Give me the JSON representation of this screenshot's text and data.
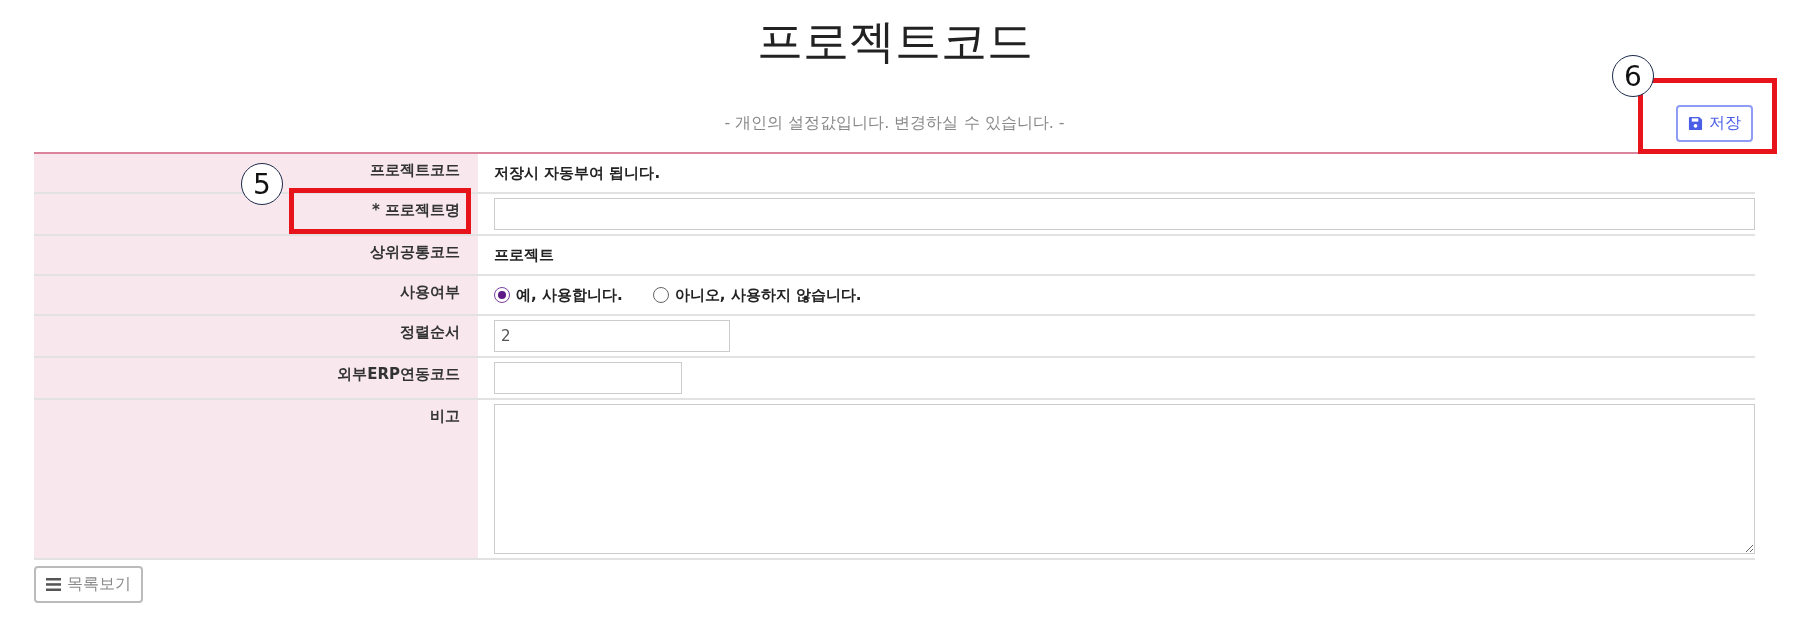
{
  "title": "프로젝트코드",
  "subtitle": "- 개인의 설정값입니다. 변경하실 수 있습니다. -",
  "save_button": "저장",
  "form": [
    {
      "kind": "text",
      "label": "프로젝트코드",
      "value": "저장시 자동부여 됩니다."
    },
    {
      "kind": "input",
      "label": "* 프로젝트명"
    },
    {
      "kind": "text",
      "label": "상위공통코드",
      "value": "프로젝트"
    },
    {
      "kind": "radio",
      "label": "사용여부",
      "options": [
        {
          "label": "예, 사용합니다.",
          "selected": true
        },
        {
          "label": "아니오, 사용하지 않습니다.",
          "selected": false
        }
      ]
    },
    {
      "kind": "input",
      "label": "정렬순서",
      "value": "2"
    },
    {
      "kind": "input",
      "label": "외부ERP연동코드"
    },
    {
      "kind": "textarea",
      "label": "비고"
    }
  ],
  "list_button": "목록보기",
  "annotations": [
    {
      "number": "5"
    },
    {
      "number": "6"
    }
  ]
}
